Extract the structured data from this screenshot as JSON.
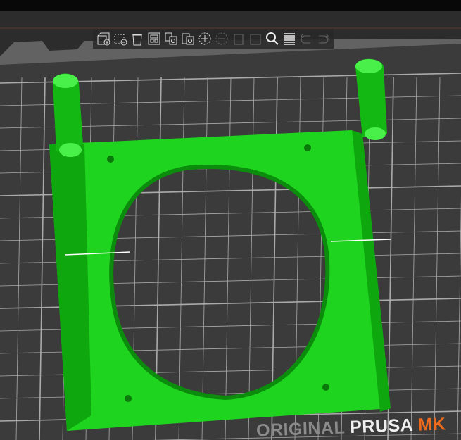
{
  "toolbar": {
    "items": [
      {
        "name": "add-icon",
        "label": "Add"
      },
      {
        "name": "delete-icon",
        "label": "Delete"
      },
      {
        "name": "delete-all-icon",
        "label": "Delete all"
      },
      {
        "name": "arrange-icon",
        "label": "Arrange"
      },
      {
        "name": "copy-icon",
        "label": "Copy"
      },
      {
        "name": "paste-icon",
        "label": "Paste"
      },
      {
        "name": "add-instance-icon",
        "label": "Add instance"
      },
      {
        "name": "remove-instance-icon",
        "label": "Remove instance"
      },
      {
        "name": "split-objects-icon",
        "label": "Split to objects"
      },
      {
        "name": "split-parts-icon",
        "label": "Split to parts"
      },
      {
        "name": "search-icon",
        "label": "Search"
      },
      {
        "name": "layers-editing-icon",
        "label": "Variable layer height"
      },
      {
        "name": "undo-icon",
        "label": "Undo"
      },
      {
        "name": "redo-icon",
        "label": "Redo"
      }
    ]
  },
  "bed": {
    "brand_1": "ORIGINAL",
    "brand_2": "PRUSA",
    "brand_3": "MK"
  },
  "colors": {
    "model": "#1fe01f",
    "bed": "#3a3a3a",
    "grid": "#d8d8d8",
    "accent": "#ec6a1c"
  }
}
